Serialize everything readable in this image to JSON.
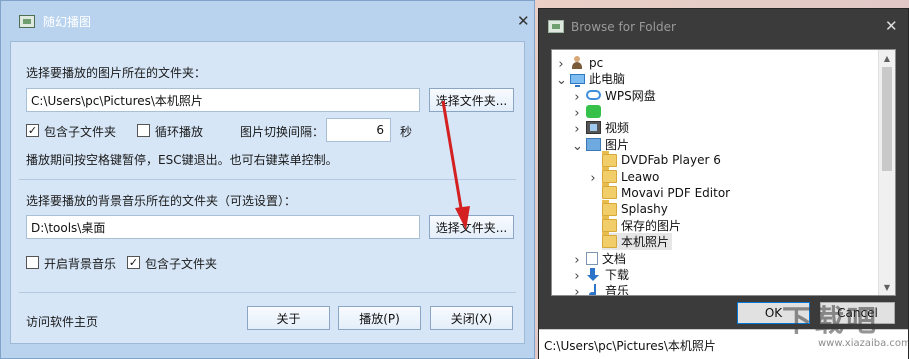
{
  "main_dialog": {
    "title": "随幻播图",
    "folder_label": "选择要播放的图片所在的文件夹：",
    "folder_path": "C:\\Users\\pc\\Pictures\\本机照片",
    "choose_folder_btn": "选择文件夹...",
    "include_subfolders": "包含子文件夹",
    "include_subfolders_checked": true,
    "loop_play": "循环播放",
    "loop_play_checked": false,
    "interval_label": "图片切换间隔：",
    "interval_value": "6",
    "interval_unit": "秒",
    "hint": "播放期间按空格键暂停，ESC键退出。也可右键菜单控制。",
    "music_label": "选择要播放的背景音乐所在的文件夹（可选设置）：",
    "music_path": "D:\\tools\\桌面",
    "choose_music_btn": "选择文件夹...",
    "enable_music": "开启背景音乐",
    "enable_music_checked": false,
    "music_subfolders": "包含子文件夹",
    "music_subfolders_checked": true,
    "homepage_link": "访问软件主页",
    "about_btn": "关于",
    "play_btn": "播放(P)",
    "close_btn": "关闭(X)"
  },
  "browse_dialog": {
    "title": "Browse for Folder",
    "tree": [
      {
        "label": "pc",
        "icon": "user-icon",
        "expander": ">",
        "depth": 1
      },
      {
        "label": "此电脑",
        "icon": "computer-icon",
        "expander": "v",
        "depth": 1
      },
      {
        "label": "WPS网盘",
        "icon": "cloud-icon",
        "expander": ">",
        "depth": 2
      },
      {
        "label": "",
        "icon": "wechat-icon",
        "expander": ">",
        "depth": 2
      },
      {
        "label": "视频",
        "icon": "video-icon",
        "expander": ">",
        "depth": 2
      },
      {
        "label": "图片",
        "icon": "pictures-icon",
        "expander": "v",
        "depth": 2
      },
      {
        "label": "DVDFab Player 6",
        "icon": "folder-icon",
        "expander": "",
        "depth": 3
      },
      {
        "label": "Leawo",
        "icon": "folder-icon",
        "expander": ">",
        "depth": 3
      },
      {
        "label": "Movavi PDF Editor",
        "icon": "folder-icon",
        "expander": "",
        "depth": 3
      },
      {
        "label": "Splashy",
        "icon": "folder-icon",
        "expander": "",
        "depth": 3
      },
      {
        "label": "保存的图片",
        "icon": "folder-icon",
        "expander": "",
        "depth": 3
      },
      {
        "label": "本机照片",
        "icon": "folder-icon",
        "expander": "",
        "depth": 3,
        "selected": true
      },
      {
        "label": "文档",
        "icon": "document-icon",
        "expander": ">",
        "depth": 2
      },
      {
        "label": "下载",
        "icon": "download-icon",
        "expander": ">",
        "depth": 2
      },
      {
        "label": "音乐",
        "icon": "music-icon",
        "expander": ">",
        "depth": 2
      }
    ],
    "ok_btn": "OK",
    "cancel_btn": "Cancel",
    "status_path": "C:\\Users\\pc\\Pictures\\本机照片"
  },
  "watermark": {
    "text": "下载吧",
    "sub": "www.xiazaiba.com"
  },
  "colors": {
    "dialog_frame": "#b9d3ee",
    "dialog_body": "#d6e6f7",
    "annotation_arrow": "#d42020",
    "browse_frame": "#3b3b3b",
    "selection": "#e6e6e6"
  }
}
